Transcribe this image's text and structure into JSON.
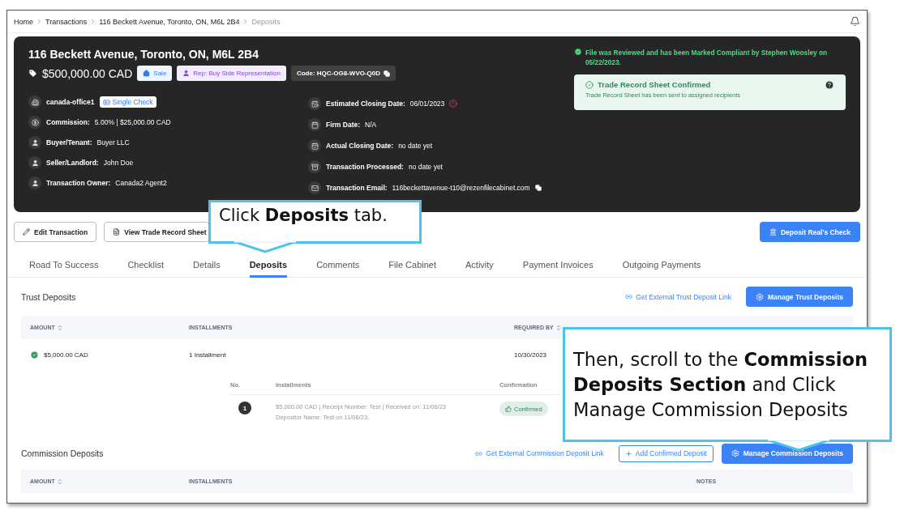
{
  "breadcrumb": [
    {
      "label": "Home",
      "current": false
    },
    {
      "label": "Transactions",
      "current": false
    },
    {
      "label": "116 Beckett Avenue, Toronto, ON, M6L 2B4",
      "current": false
    },
    {
      "label": "Deposits",
      "current": true
    }
  ],
  "header": {
    "title": "116 Beckett Avenue, Toronto, ON, M6L 2B4",
    "price": "$500,000.00 CAD",
    "badges": [
      {
        "kind": "sale",
        "label": "Sale"
      },
      {
        "kind": "rep",
        "label": "Rep: Buy Side Representation"
      },
      {
        "kind": "code",
        "label": "Code: HQC-OG8-WVO-Q0D"
      }
    ],
    "left_details": [
      {
        "kind": "office",
        "label": "canada-office1",
        "tag": "Single Check"
      },
      {
        "kind": "commission",
        "label": "Commission:",
        "value": "5.00% | $25,000.00 CAD"
      },
      {
        "kind": "person",
        "label": "Buyer/Tenant:",
        "value": "Buyer LLC"
      },
      {
        "kind": "person",
        "label": "Seller/Landlord:",
        "value": "John Doe"
      },
      {
        "kind": "person",
        "label": "Transaction Owner:",
        "value": "Canada2 Agent2"
      }
    ],
    "right_details": [
      {
        "kind": "calendar-clock",
        "label": "Estimated Closing Date:",
        "value": "06/01/2023",
        "warning": true
      },
      {
        "kind": "calendar",
        "label": "Firm Date:",
        "value": "N/A",
        "warning": false
      },
      {
        "kind": "calendar-check",
        "label": "Actual Closing Date:",
        "value": "no date yet",
        "warning": false
      },
      {
        "kind": "processed",
        "label": "Transaction Processed:",
        "value": "no date yet",
        "warning": false
      },
      {
        "kind": "email",
        "label": "Transaction Email:",
        "value": "116beckettavenue-t10@rezenfilecabinet.com",
        "warning": false
      }
    ],
    "compliance": "File was Reviewed and has been Marked Compliant by Stephen Woosley on 05/22/2023.",
    "notice": {
      "title": "Trade Record Sheet Confirmed",
      "text": "Trade Record Sheet has been sent to assigned recipients"
    }
  },
  "actions": {
    "left": [
      {
        "kind": "edit",
        "label": "Edit Transaction"
      },
      {
        "kind": "view",
        "label": "View Trade Record Sheet"
      }
    ],
    "right": "Deposit Real's Check"
  },
  "tabs": [
    {
      "label": "Road To Success",
      "selected": false
    },
    {
      "label": "Checklist",
      "selected": false
    },
    {
      "label": "Details",
      "selected": false
    },
    {
      "label": "Deposits",
      "selected": true
    },
    {
      "label": "Comments",
      "selected": false
    },
    {
      "label": "File Cabinet",
      "selected": false
    },
    {
      "label": "Activity",
      "selected": false
    },
    {
      "label": "Payment Invoices",
      "selected": false
    },
    {
      "label": "Outgoing Payments",
      "selected": false
    }
  ],
  "trust_deposits": {
    "title": "Trust Deposits",
    "link": "Get External Trust Deposit Link",
    "button": "Manage Trust Deposits",
    "columns": [
      {
        "label": "AMOUNT",
        "sortable": true
      },
      {
        "label": "INSTALLMENTS",
        "sortable": false
      },
      {
        "label": "REQUIRED BY",
        "sortable": true
      }
    ],
    "rows": [
      {
        "amount": "$5,000.00 CAD",
        "confirmed": true,
        "installments": "1 Installment",
        "required_by": "10/30/2023"
      }
    ],
    "installment_columns": [
      "No.",
      "Installments",
      "Confirmation"
    ],
    "installments": [
      {
        "number": "1",
        "lines": [
          "$5,000.00 CAD | Receipt Number: Test | Received on: 11/06/23",
          "Depositor Name: Test on 11/06/23."
        ],
        "status": "Confirmed"
      }
    ]
  },
  "commission_deposits": {
    "title": "Commission Deposits",
    "link": "Get External Commission Deposit Link",
    "add_button": "Add Confirmed Deposit",
    "button": "Manage Commission Deposits",
    "columns": [
      {
        "label": "AMOUNT",
        "sortable": true
      },
      {
        "label": "INSTALLMENTS",
        "sortable": false
      },
      {
        "label": "NOTES",
        "sortable": false
      }
    ]
  },
  "callouts": [
    {
      "text": "Click **Deposits** tab."
    },
    {
      "text": "Then, scroll to the **Commission Deposits Section** and Click Manage Commission Deposits"
    }
  ]
}
